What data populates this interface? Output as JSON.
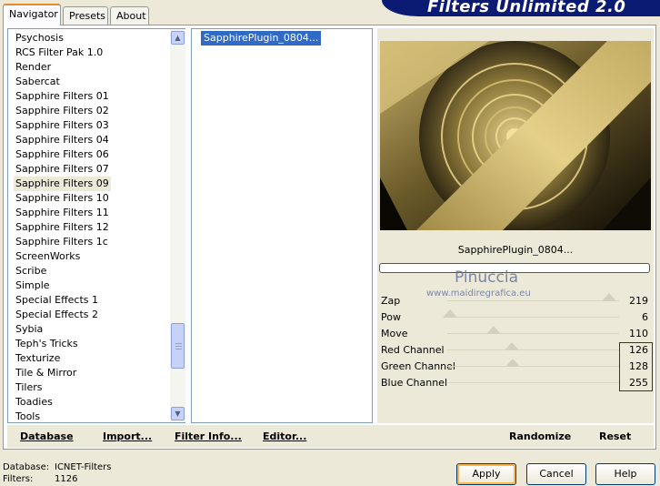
{
  "tabs": [
    "Navigator",
    "Presets",
    "About"
  ],
  "title": "Filters Unlimited 2.0",
  "filter_list": {
    "items": [
      "Psychosis",
      "RCS Filter Pak 1.0",
      "Render",
      "Sabercat",
      "Sapphire Filters 01",
      "Sapphire Filters 02",
      "Sapphire Filters 03",
      "Sapphire Filters 04",
      "Sapphire Filters 06",
      "Sapphire Filters 07",
      "Sapphire Filters 09",
      "Sapphire Filters 10",
      "Sapphire Filters 11",
      "Sapphire Filters 12",
      "Sapphire Filters 1c",
      "ScreenWorks",
      "Scribe",
      "Simple",
      "Special Effects 1",
      "Special Effects 2",
      "Sybia",
      "Teph's Tricks",
      "Texturize",
      "Tile & Mirror",
      "Tilers",
      "Toadies",
      "Tools"
    ],
    "selected": "Sapphire Filters 09"
  },
  "plugin_list": {
    "items": [
      "SapphirePlugin_0804..."
    ]
  },
  "preview": {
    "name": "SapphirePlugin_0804...",
    "watermark_name": "Pinuccia",
    "watermark_url": "www.maidiregrafica.eu"
  },
  "params": [
    {
      "label": "Zap",
      "value": "219"
    },
    {
      "label": "Pow",
      "value": "6"
    },
    {
      "label": "Move",
      "value": "110"
    },
    {
      "label": "Red Channel",
      "value": "126"
    },
    {
      "label": "Green Channel",
      "value": "128"
    },
    {
      "label": "Blue Channel",
      "value": "255"
    }
  ],
  "buttons": {
    "database": "Database",
    "import": "Import...",
    "filter_info": "Filter Info...",
    "editor": "Editor...",
    "randomize": "Randomize",
    "reset": "Reset",
    "apply": "Apply",
    "cancel": "Cancel",
    "help": "Help"
  },
  "status": {
    "database_label": "Database:",
    "database_value": "ICNET-Filters",
    "filters_label": "Filters:",
    "filters_value": "1126"
  },
  "colors": {
    "title_banner": "#0b1a72",
    "selection": "#316ac5",
    "tab_highlight": "#e68b2c"
  }
}
